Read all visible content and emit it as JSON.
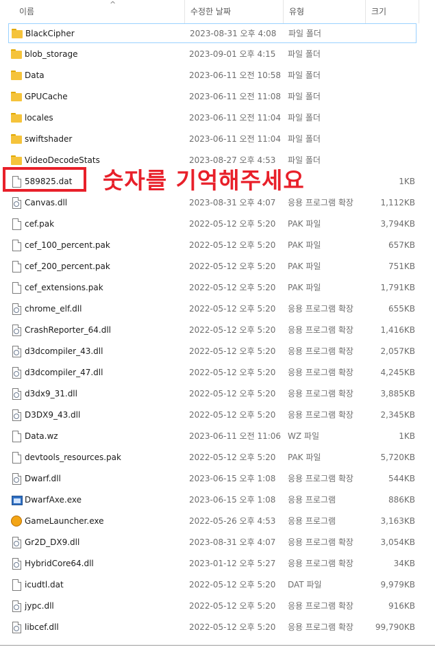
{
  "columns": {
    "name": "이름",
    "date": "수정한 날짜",
    "type": "유형",
    "size": "크기"
  },
  "annotation": {
    "text": "숫자를 기억해주세요",
    "color": "#e8202a"
  },
  "rows": [
    {
      "name": "BlackCipher",
      "date": "2023-08-31 오후 4:08",
      "type": "파일 폴더",
      "size": "",
      "icon": "folder-icon",
      "selected": true
    },
    {
      "name": "blob_storage",
      "date": "2023-09-01 오후 4:15",
      "type": "파일 폴더",
      "size": "",
      "icon": "folder-icon"
    },
    {
      "name": "Data",
      "date": "2023-06-11 오전 10:58",
      "type": "파일 폴더",
      "size": "",
      "icon": "folder-icon"
    },
    {
      "name": "GPUCache",
      "date": "2023-06-11 오전 11:08",
      "type": "파일 폴더",
      "size": "",
      "icon": "folder-icon"
    },
    {
      "name": "locales",
      "date": "2023-06-11 오전 11:04",
      "type": "파일 폴더",
      "size": "",
      "icon": "folder-icon"
    },
    {
      "name": "swiftshader",
      "date": "2023-06-11 오전 11:04",
      "type": "파일 폴더",
      "size": "",
      "icon": "folder-icon"
    },
    {
      "name": "VideoDecodeStats",
      "date": "2023-08-27 오후 4:53",
      "type": "파일 폴더",
      "size": "",
      "icon": "folder-icon"
    },
    {
      "name": "589825.dat",
      "date": "",
      "type": "",
      "size": "1KB",
      "icon": "file-icon"
    },
    {
      "name": "Canvas.dll",
      "date": "2023-08-31 오후 4:07",
      "type": "응용 프로그램 확장",
      "size": "1,112KB",
      "icon": "dll-icon"
    },
    {
      "name": "cef.pak",
      "date": "2022-05-12 오후 5:20",
      "type": "PAK 파일",
      "size": "3,794KB",
      "icon": "file-icon"
    },
    {
      "name": "cef_100_percent.pak",
      "date": "2022-05-12 오후 5:20",
      "type": "PAK 파일",
      "size": "657KB",
      "icon": "file-icon"
    },
    {
      "name": "cef_200_percent.pak",
      "date": "2022-05-12 오후 5:20",
      "type": "PAK 파일",
      "size": "751KB",
      "icon": "file-icon"
    },
    {
      "name": "cef_extensions.pak",
      "date": "2022-05-12 오후 5:20",
      "type": "PAK 파일",
      "size": "1,791KB",
      "icon": "file-icon"
    },
    {
      "name": "chrome_elf.dll",
      "date": "2022-05-12 오후 5:20",
      "type": "응용 프로그램 확장",
      "size": "655KB",
      "icon": "dll-icon"
    },
    {
      "name": "CrashReporter_64.dll",
      "date": "2022-05-12 오후 5:20",
      "type": "응용 프로그램 확장",
      "size": "1,416KB",
      "icon": "dll-icon"
    },
    {
      "name": "d3dcompiler_43.dll",
      "date": "2022-05-12 오후 5:20",
      "type": "응용 프로그램 확장",
      "size": "2,057KB",
      "icon": "dll-icon"
    },
    {
      "name": "d3dcompiler_47.dll",
      "date": "2022-05-12 오후 5:20",
      "type": "응용 프로그램 확장",
      "size": "4,245KB",
      "icon": "dll-icon"
    },
    {
      "name": "d3dx9_31.dll",
      "date": "2022-05-12 오후 5:20",
      "type": "응용 프로그램 확장",
      "size": "3,885KB",
      "icon": "dll-icon"
    },
    {
      "name": "D3DX9_43.dll",
      "date": "2022-05-12 오후 5:20",
      "type": "응용 프로그램 확장",
      "size": "2,345KB",
      "icon": "dll-icon"
    },
    {
      "name": "Data.wz",
      "date": "2023-06-11 오전 11:06",
      "type": "WZ 파일",
      "size": "1KB",
      "icon": "file-icon"
    },
    {
      "name": "devtools_resources.pak",
      "date": "2022-05-12 오후 5:20",
      "type": "PAK 파일",
      "size": "5,720KB",
      "icon": "file-icon"
    },
    {
      "name": "Dwarf.dll",
      "date": "2023-06-15 오후 1:08",
      "type": "응용 프로그램 확장",
      "size": "544KB",
      "icon": "dll-icon"
    },
    {
      "name": "DwarfAxe.exe",
      "date": "2023-06-15 오후 1:08",
      "type": "응용 프로그램",
      "size": "886KB",
      "icon": "exe-icon"
    },
    {
      "name": "GameLauncher.exe",
      "date": "2022-05-26 오후 4:53",
      "type": "응용 프로그램",
      "size": "3,163KB",
      "icon": "game-icon"
    },
    {
      "name": "Gr2D_DX9.dll",
      "date": "2023-08-31 오후 4:07",
      "type": "응용 프로그램 확장",
      "size": "3,054KB",
      "icon": "dll-icon"
    },
    {
      "name": "HybridCore64.dll",
      "date": "2023-01-12 오후 5:27",
      "type": "응용 프로그램 확장",
      "size": "34KB",
      "icon": "dll-icon"
    },
    {
      "name": "icudtl.dat",
      "date": "2022-05-12 오후 5:20",
      "type": "DAT 파일",
      "size": "9,979KB",
      "icon": "file-icon"
    },
    {
      "name": "jypc.dll",
      "date": "2022-05-12 오후 5:20",
      "type": "응용 프로그램 확장",
      "size": "916KB",
      "icon": "dll-icon"
    },
    {
      "name": "libcef.dll",
      "date": "2022-05-12 오후 5:20",
      "type": "응용 프로그램 확장",
      "size": "99,790KB",
      "icon": "dll-icon"
    }
  ]
}
